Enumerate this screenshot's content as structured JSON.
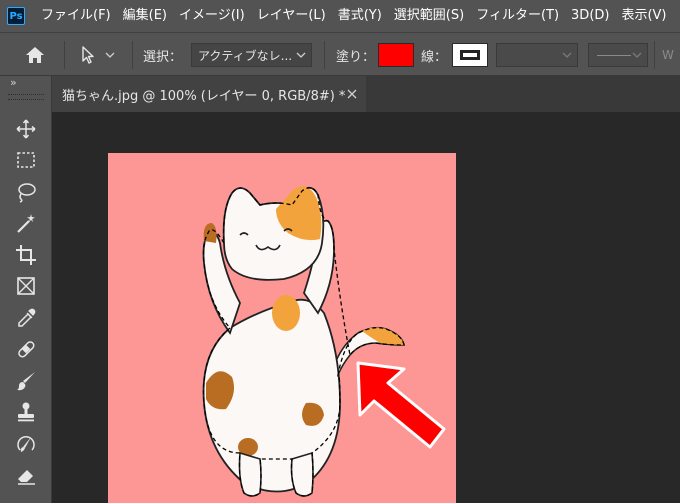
{
  "app": {
    "logo_text": "Ps"
  },
  "menu": [
    {
      "label": "ファイル(F)"
    },
    {
      "label": "編集(E)"
    },
    {
      "label": "イメージ(I)"
    },
    {
      "label": "レイヤー(L)"
    },
    {
      "label": "書式(Y)"
    },
    {
      "label": "選択範囲(S)"
    },
    {
      "label": "フィルター(T)"
    },
    {
      "label": "3D(D)"
    },
    {
      "label": "表示(V)"
    }
  ],
  "options": {
    "select_label": "選択：",
    "select_value": "アクティブなレ...",
    "fill_label": "塗り：",
    "fill_color": "#ff0000",
    "stroke_label": "線：",
    "width_label": "W"
  },
  "document_tab": {
    "title": "猫ちゃん.jpg @ 100% (レイヤー 0, RGB/8#) *"
  },
  "toolbar": {
    "collapse_glyph": "»"
  },
  "tools": [
    {
      "name": "move-tool-icon"
    },
    {
      "name": "rectangular-marquee-icon"
    },
    {
      "name": "lasso-icon"
    },
    {
      "name": "magic-wand-icon"
    },
    {
      "name": "crop-icon"
    },
    {
      "name": "frame-icon"
    },
    {
      "name": "eyedropper-icon"
    },
    {
      "name": "healing-brush-icon"
    },
    {
      "name": "brush-icon"
    },
    {
      "name": "clone-stamp-icon"
    },
    {
      "name": "history-brush-icon"
    },
    {
      "name": "eraser-icon"
    }
  ],
  "canvas": {
    "background": "#fd9796",
    "subject": "cat-illustration",
    "arrow_color": "#ff0000"
  }
}
